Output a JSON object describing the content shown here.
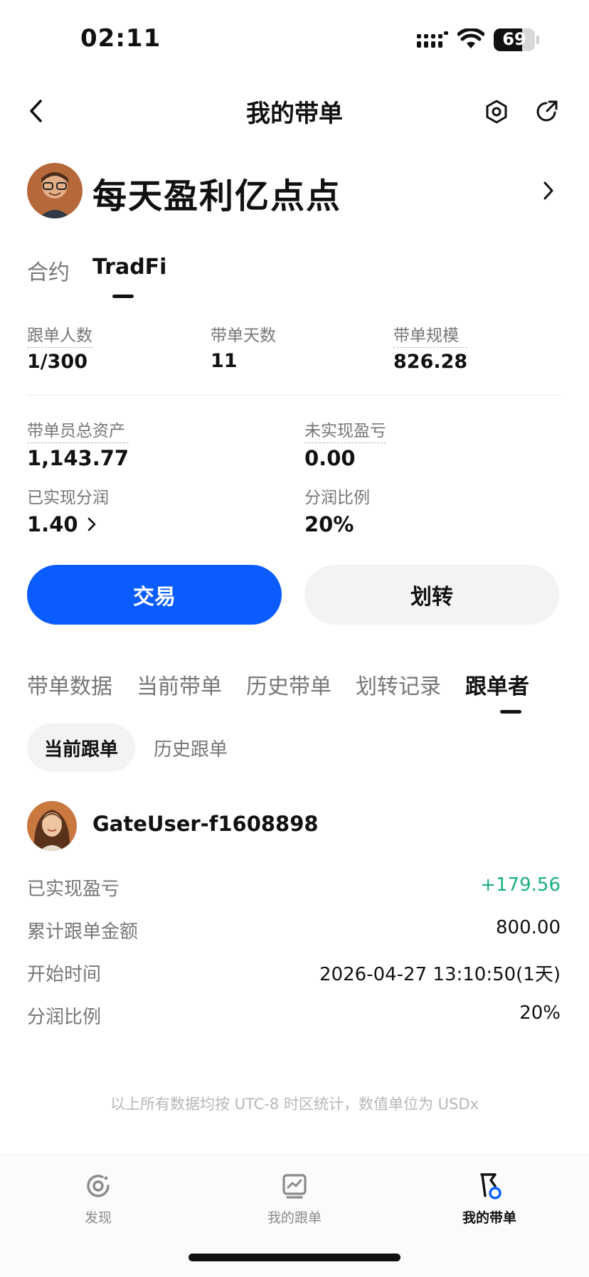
{
  "status_bar": {
    "time": "02:11",
    "battery": "69"
  },
  "header": {
    "title": "我的带单"
  },
  "profile": {
    "nickname": "每天盈利亿点点"
  },
  "product_tabs": [
    {
      "label": "合约",
      "active": false
    },
    {
      "label": "TradFi",
      "active": true
    }
  ],
  "stats_row1": [
    {
      "label": "跟单人数",
      "value": "1/300"
    },
    {
      "label": "带单天数",
      "value": "11"
    },
    {
      "label": "带单规模",
      "value": "826.28"
    }
  ],
  "stats_grid": {
    "total_assets": {
      "label": "带单员总资产",
      "value": "1,143.77"
    },
    "unrealized_pnl": {
      "label": "未实现盈亏",
      "value": "0.00"
    },
    "realized_share": {
      "label": "已实现分润",
      "value": "1.40"
    },
    "share_ratio": {
      "label": "分润比例",
      "value": "20%"
    }
  },
  "actions": {
    "trade": "交易",
    "transfer": "划转"
  },
  "section_tabs": [
    "带单数据",
    "当前带单",
    "历史带单",
    "划转记录",
    "跟单者"
  ],
  "section_tab_active": "跟单者",
  "sub_tabs": [
    "当前跟单",
    "历史跟单"
  ],
  "follower": {
    "name": "GateUser-f1608898",
    "rows": [
      {
        "label": "已实现盈亏",
        "value": "+179.56"
      },
      {
        "label": "累计跟单金额",
        "value": "800.00"
      },
      {
        "label": "开始时间",
        "value": "2026-04-27 13:10:50(1天)"
      },
      {
        "label": "分润比例",
        "value": "20%"
      }
    ]
  },
  "footnote": "以上所有数据均按 UTC-8 时区统计，数值单位为 USDx",
  "bottom_nav": [
    {
      "label": "发现",
      "icon": "discover-icon"
    },
    {
      "label": "我的跟单",
      "icon": "chart-icon"
    },
    {
      "label": "我的带单",
      "icon": "flag-icon",
      "active": true
    }
  ],
  "colors": {
    "primary": "#0a5cfe",
    "positive": "#1bb27a",
    "muted": "#767676"
  }
}
